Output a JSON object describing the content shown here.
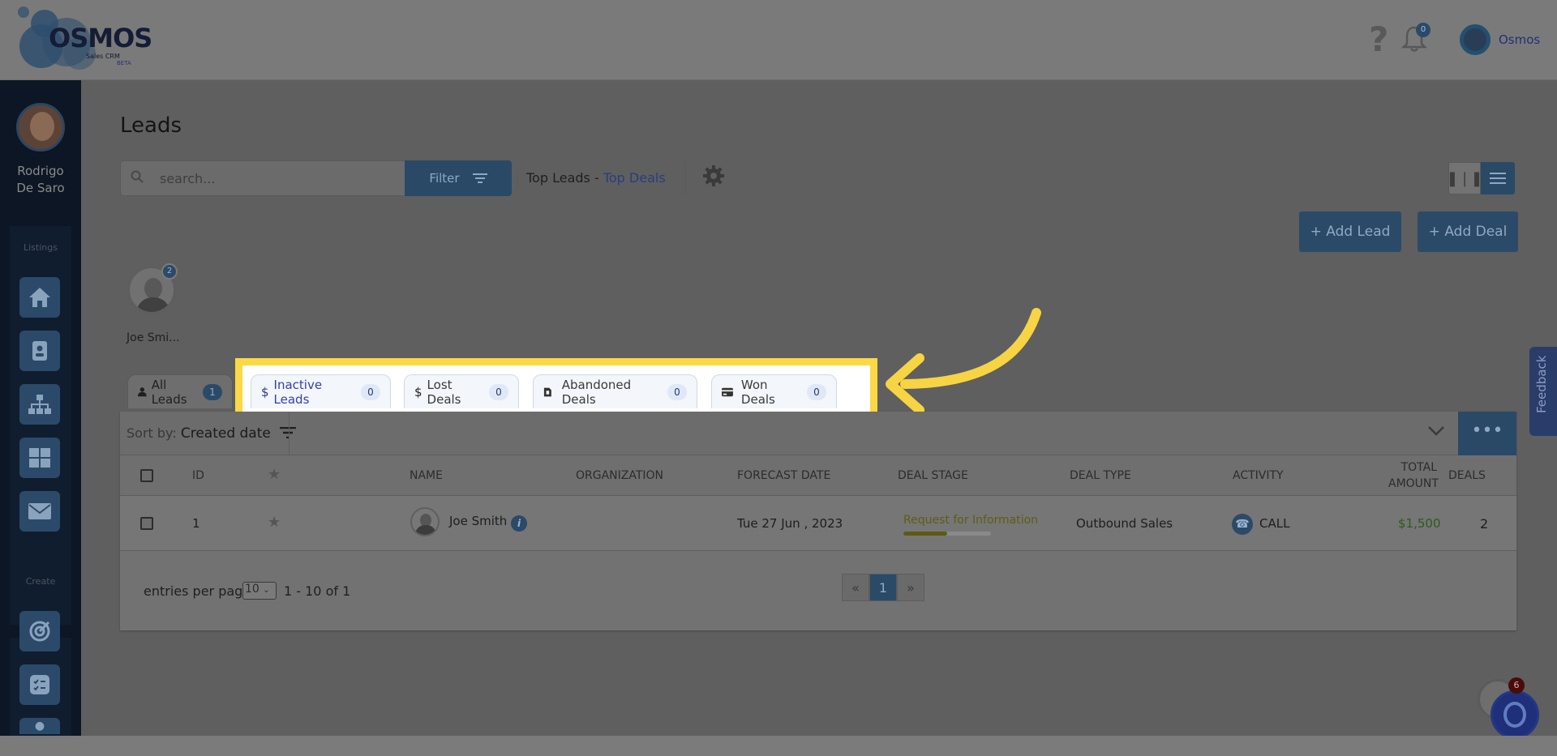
{
  "app": {
    "logo_text": "OSMOS",
    "logo_sub": "Sales CRM",
    "logo_beta": "BETA",
    "help_symbol": "?",
    "notifications_count": "0",
    "user_name": "Osmos"
  },
  "sidebar": {
    "user_name_line1": "Rodrigo",
    "user_name_line2": "De Saro",
    "listings_label": "Listings",
    "create_label": "Create",
    "listing_icons": [
      "home-icon",
      "contact-card-icon",
      "org-chart-icon",
      "dashboard-grid-icon",
      "mail-icon"
    ],
    "create_icons": [
      "target-icon",
      "checklist-icon",
      "more-icon"
    ]
  },
  "page": {
    "title": "Leads",
    "search_placeholder": "search...",
    "filter_label": "Filter",
    "top_leads_label": "Top Leads -",
    "top_deals_label": "Top Deals",
    "add_lead_label": "+ Add Lead",
    "add_deal_label": "+ Add Deal"
  },
  "top_lead": {
    "name": "Joe Smi...",
    "count": "2"
  },
  "tabs": [
    {
      "label": "All Leads",
      "count": "1",
      "icon": "person-icon"
    },
    {
      "label": "Inactive Leads",
      "count": "0",
      "icon": "dollar-icon"
    },
    {
      "label": "Lost Deals",
      "count": "0",
      "icon": "dollar-icon"
    },
    {
      "label": "Abandoned Deals",
      "count": "0",
      "icon": "file-icon"
    },
    {
      "label": "Won Deals",
      "count": "0",
      "icon": "card-icon"
    }
  ],
  "sort": {
    "prefix": "Sort by:",
    "value": "Created date"
  },
  "table": {
    "headers": {
      "id": "ID",
      "name": "NAME",
      "organization": "ORGANIZATION",
      "forecast": "FORECAST DATE",
      "stage": "DEAL STAGE",
      "type": "DEAL TYPE",
      "activity": "ACTIVITY",
      "total_line1": "TOTAL",
      "total_line2": "AMOUNT",
      "deals": "DEALS"
    },
    "rows": [
      {
        "id": "1",
        "name": "Joe Smith",
        "organization": "",
        "forecast": "Tue 27 Jun , 2023",
        "stage": "Request for Information",
        "stage_progress": 0.5,
        "type": "Outbound Sales",
        "activity": "CALL",
        "amount": "$1,500",
        "deals": "2"
      }
    ]
  },
  "pagination": {
    "entries_label": "entries per page",
    "entries_value": "10",
    "range": "1 - 10 of 1",
    "prev": "«",
    "current": "1",
    "next": "»"
  },
  "feedback_label": "Feedback",
  "chat_badge": "6",
  "colors": {
    "highlight": "#fbd945",
    "accent": "#2b4a68",
    "active_tab_text": "#3440b0"
  }
}
